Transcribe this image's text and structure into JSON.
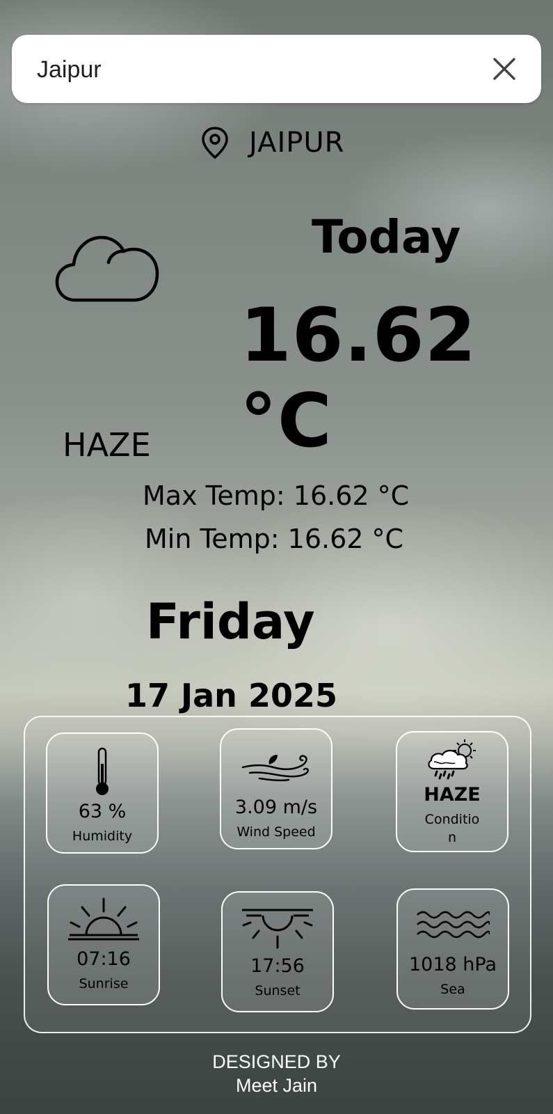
{
  "search": {
    "value": "Jaipur",
    "clear_icon": "close-icon"
  },
  "location": {
    "icon": "map-pin-icon",
    "city": "JAIPUR"
  },
  "weather": {
    "icon": "cloud-icon",
    "today_label": "Today",
    "temperature": "16.62 °C",
    "condition": "HAZE",
    "max_temp": "Max Temp: 16.62 °C",
    "min_temp": "Min Temp: 16.62 °C",
    "day": "Friday",
    "date": "17 Jan 2025"
  },
  "details": [
    {
      "icon": "thermometer-icon",
      "value": "63 %",
      "label": "Humidity"
    },
    {
      "icon": "wind-icon",
      "value": "3.09 m/s",
      "label": "Wind Speed"
    },
    {
      "icon": "rain-sun-icon",
      "value": "HAZE",
      "label": "Conditio\nn"
    },
    {
      "icon": "sunrise-icon",
      "value": "07:16",
      "label": "Sunrise"
    },
    {
      "icon": "sunset-icon",
      "value": "17:56",
      "label": "Sunset"
    },
    {
      "icon": "waves-icon",
      "value": "1018 hPa",
      "label": "Sea"
    }
  ],
  "footer": {
    "line1": "DESIGNED BY",
    "line2": "Meet Jain"
  }
}
